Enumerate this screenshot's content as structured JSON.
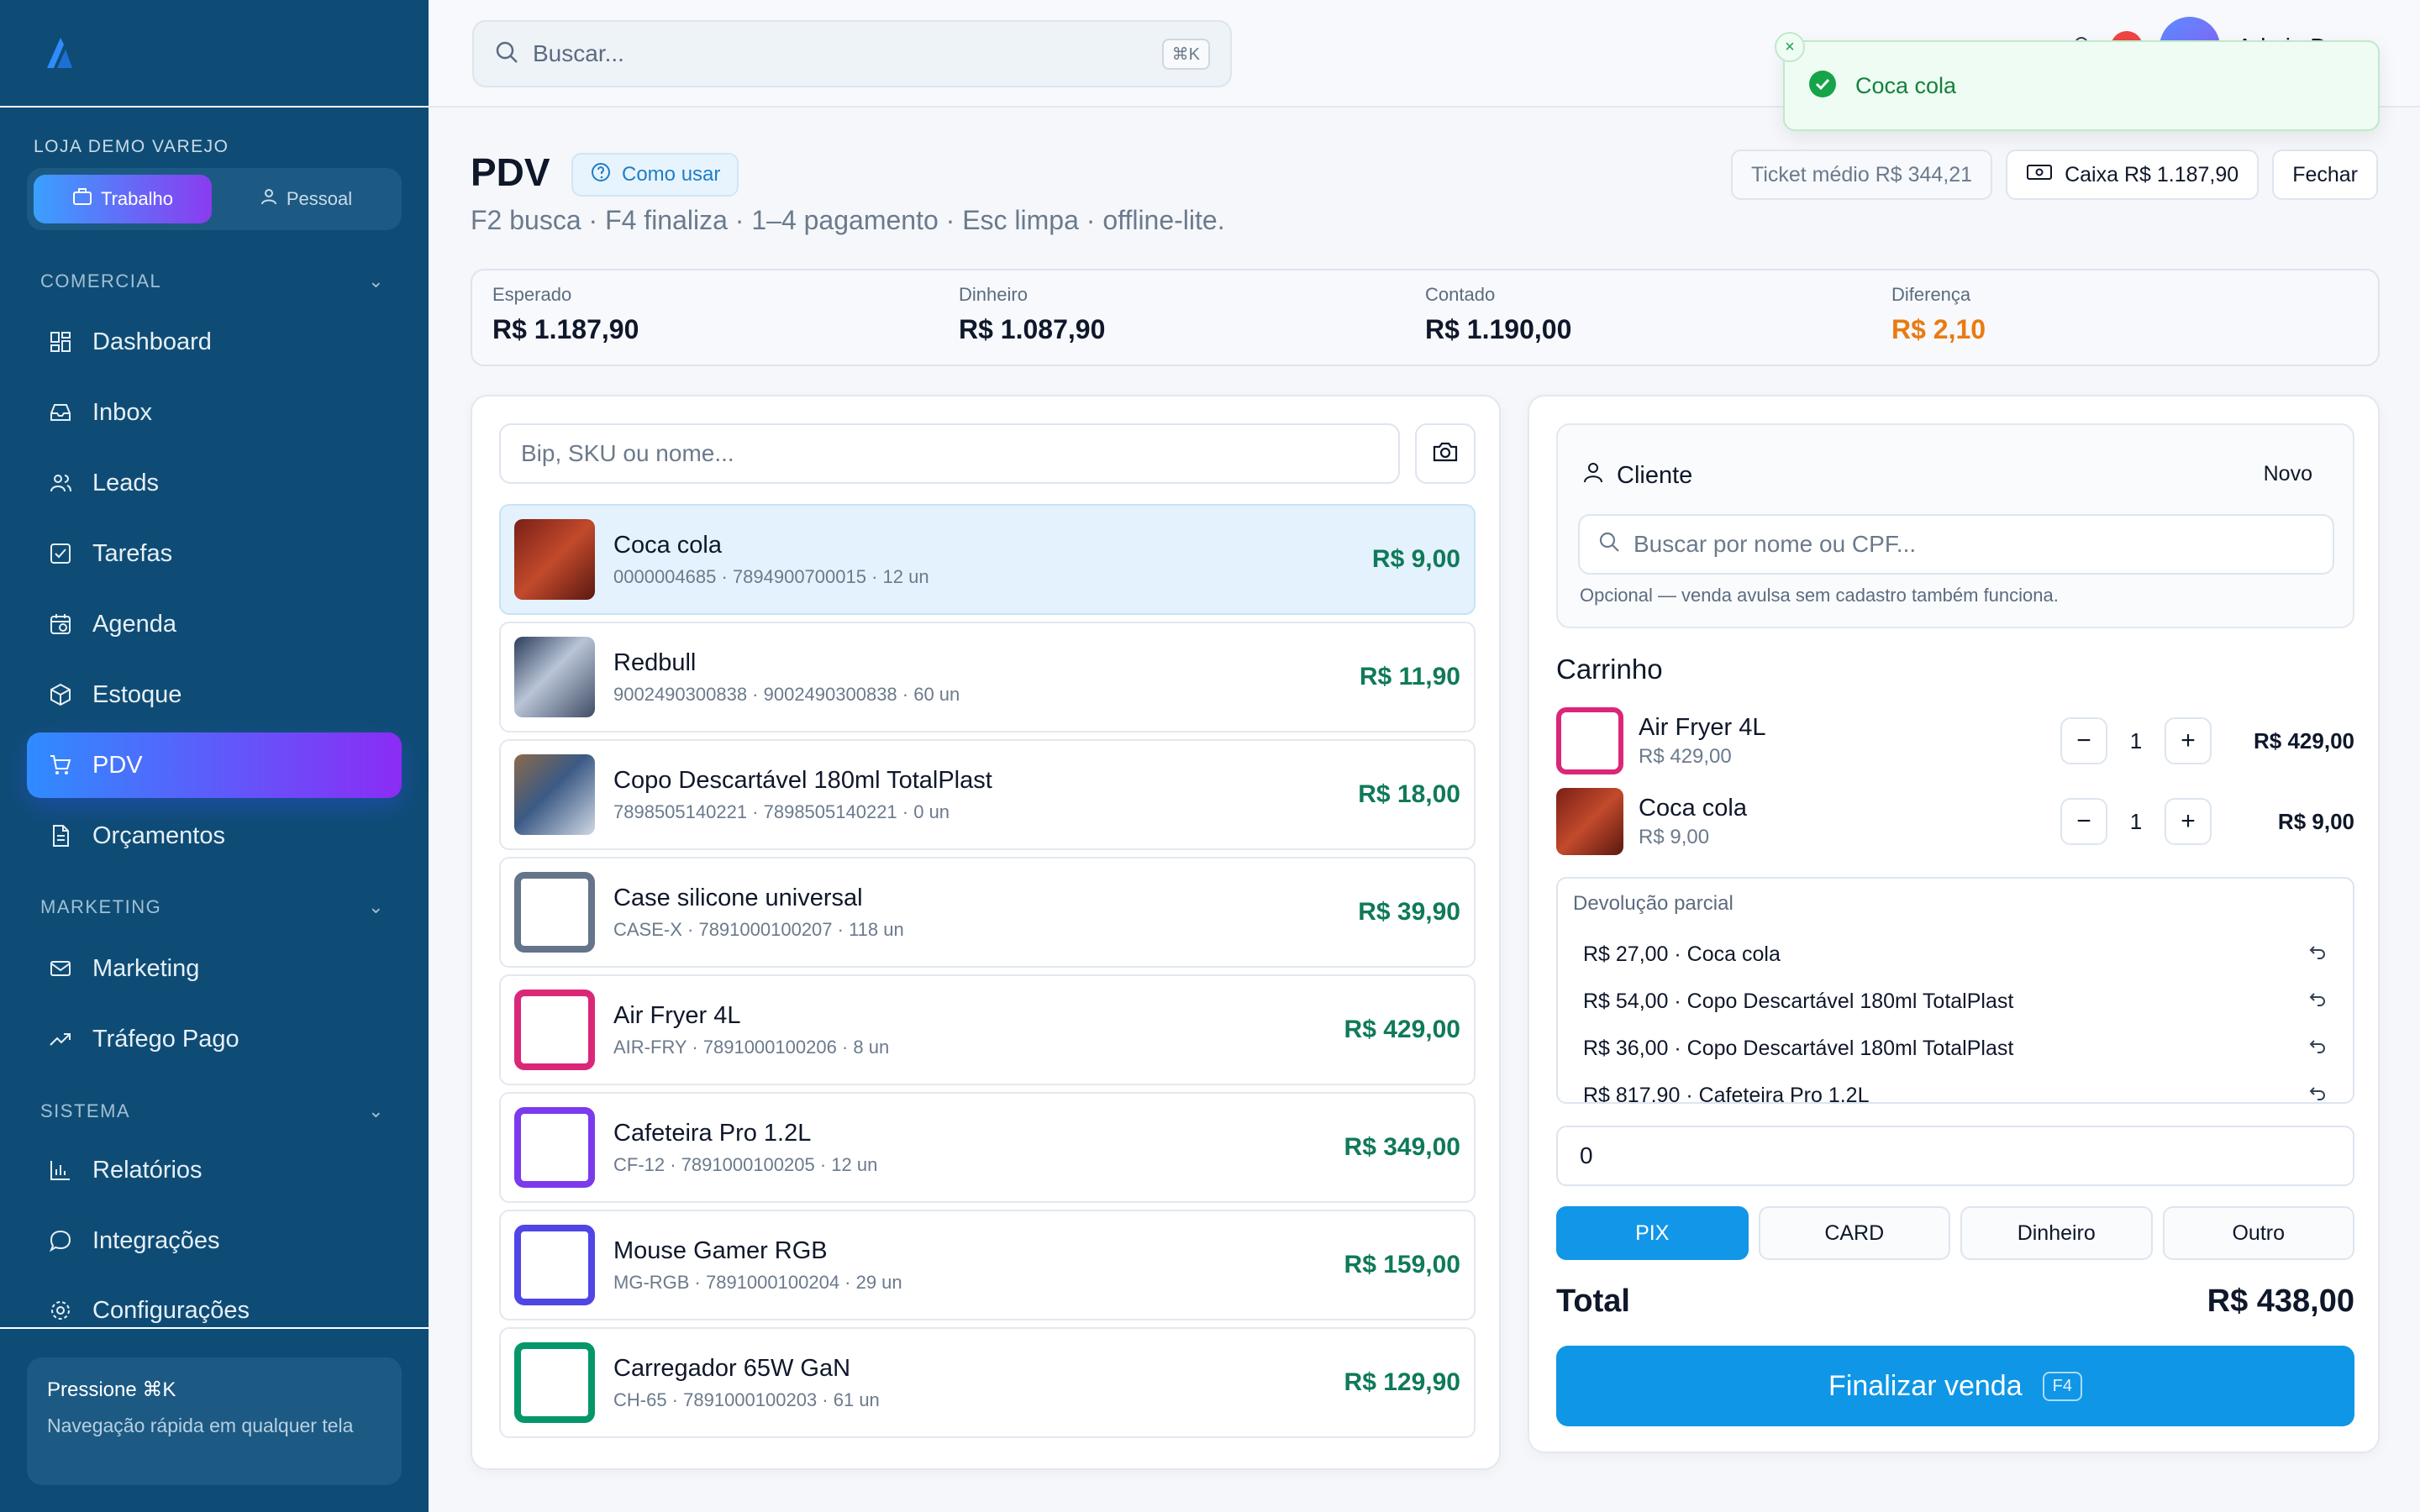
{
  "sidebar": {
    "store_label": "LOJA DEMO VAREJO",
    "mode": [
      {
        "label": "Trabalho",
        "active": true
      },
      {
        "label": "Pessoal",
        "active": false
      }
    ],
    "sections": {
      "comercial": "COMERCIAL",
      "marketing": "MARKETING",
      "sistema": "SISTEMA"
    },
    "items": [
      {
        "label": "Dashboard",
        "icon": "dashboard-icon"
      },
      {
        "label": "Inbox",
        "icon": "inbox-icon"
      },
      {
        "label": "Leads",
        "icon": "users-icon"
      },
      {
        "label": "Tarefas",
        "icon": "checkbox-icon"
      },
      {
        "label": "Agenda",
        "icon": "calendar-icon"
      },
      {
        "label": "Estoque",
        "icon": "box-icon"
      },
      {
        "label": "PDV",
        "icon": "cart-icon",
        "active": true
      },
      {
        "label": "Orçamentos",
        "icon": "document-icon"
      },
      {
        "label": "Marketing",
        "icon": "mail-icon"
      },
      {
        "label": "Tráfego Pago",
        "icon": "trending-icon"
      },
      {
        "label": "Relatórios",
        "icon": "bar-chart-icon"
      },
      {
        "label": "Integrações",
        "icon": "chat-icon"
      },
      {
        "label": "Configurações",
        "icon": "gear-icon"
      }
    ],
    "hint": {
      "title": "Pressione ⌘K",
      "text": "Navegação rápida em qualquer tela"
    }
  },
  "topbar": {
    "search_placeholder": "Buscar...",
    "search_kbd": "⌘K",
    "user_name": "Admin Demo",
    "badge": "20"
  },
  "toast": {
    "text": "Coca cola",
    "close": "×"
  },
  "page": {
    "title": "PDV",
    "how_to": "Como usar",
    "subtitle": "F2 busca · F4 finaliza · 1–4 pagamento · Esc limpa · offline-lite.",
    "ticket": "Ticket médio R$ 344,21",
    "caixa": "Caixa R$ 1.187,90",
    "fechar": "Fechar"
  },
  "summary": [
    {
      "label": "Esperado",
      "value": "R$ 1.187,90"
    },
    {
      "label": "Dinheiro",
      "value": "R$ 1.087,90"
    },
    {
      "label": "Contado",
      "value": "R$ 1.190,00"
    },
    {
      "label": "Diferença",
      "value": "R$ 2,10"
    }
  ],
  "products_panel": {
    "search_placeholder": "Bip, SKU ou nome...",
    "products": [
      {
        "name": "Coca cola",
        "meta": "0000004685 · 7894900700015 · 12 un",
        "price": "R$ 9,00",
        "selected": true,
        "thumb": "#a8382a"
      },
      {
        "name": "Redbull",
        "meta": "9002490300838 · 9002490300838 · 60 un",
        "price": "R$ 11,90",
        "thumb": "#6a7c99"
      },
      {
        "name": "Copo Descartável 180ml TotalPlast",
        "meta": "7898505140221 · 7898505140221 · 0 un",
        "price": "R$ 18,00",
        "thumb": "#5a6f8a"
      },
      {
        "name": "Case silicone universal",
        "meta": "CASE-X · 7891000100207 · 118 un",
        "price": "R$ 39,90",
        "border": "#64748b"
      },
      {
        "name": "Air Fryer 4L",
        "meta": "AIR-FRY · 7891000100206 · 8 un",
        "price": "R$ 429,00",
        "border": "#db2777"
      },
      {
        "name": "Cafeteira Pro 1.2L",
        "meta": "CF-12 · 7891000100205 · 12 un",
        "price": "R$ 349,00",
        "border": "#7c3aed"
      },
      {
        "name": "Mouse Gamer RGB",
        "meta": "MG-RGB · 7891000100204 · 29 un",
        "price": "R$ 159,00",
        "border": "#4f46e5"
      },
      {
        "name": "Carregador 65W GaN",
        "meta": "CH-65 · 7891000100203 · 61 un",
        "price": "R$ 129,90",
        "border": "#059669"
      }
    ]
  },
  "checkout": {
    "client_title": "Cliente",
    "client_new": "Novo",
    "client_search_placeholder": "Buscar por nome ou CPF...",
    "client_note": "Opcional — venda avulsa sem cadastro também funciona.",
    "cart_title": "Carrinho",
    "cart": [
      {
        "name": "Air Fryer 4L",
        "unit": "R$ 429,00",
        "qty": "1",
        "total": "R$ 429,00",
        "border": "#db2777"
      },
      {
        "name": "Coca cola",
        "unit": "R$ 9,00",
        "qty": "1",
        "total": "R$ 9,00",
        "thumb": "#a8382a"
      }
    ],
    "returns_title": "Devolução parcial",
    "returns": [
      "R$ 27,00 · Coca cola",
      "R$ 54,00 · Copo Descartável 180ml TotalPlast",
      "R$ 36,00 · Copo Descartável 180ml TotalPlast",
      "R$ 817,90 · Cafeteira Pro 1.2L"
    ],
    "amount": "0",
    "payment_methods": [
      {
        "label": "PIX",
        "active": true
      },
      {
        "label": "CARD"
      },
      {
        "label": "Dinheiro"
      },
      {
        "label": "Outro"
      }
    ],
    "total_label": "Total",
    "total_value": "R$ 438,00",
    "finalize_label": "Finalizar venda",
    "finalize_kbd": "F4"
  }
}
